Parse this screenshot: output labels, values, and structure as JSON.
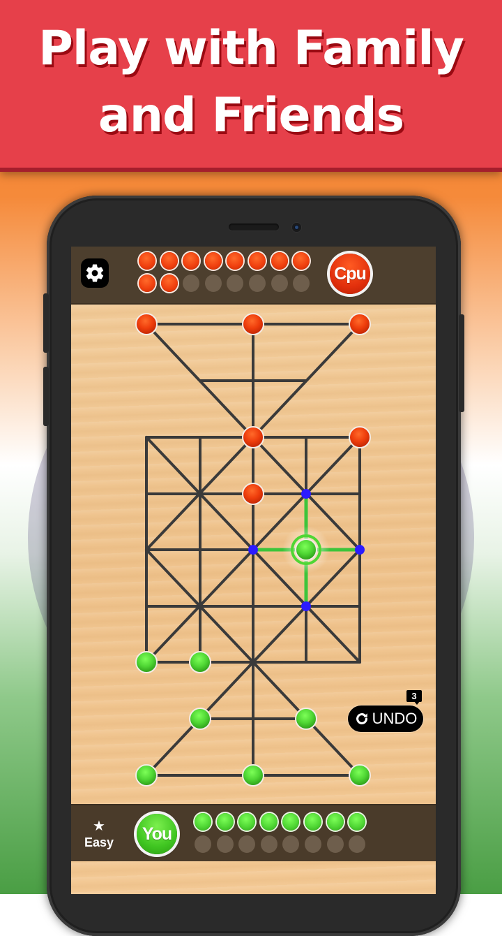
{
  "banner": {
    "line1": "Play with Family",
    "line2": "and Friends"
  },
  "colors": {
    "banner": "#e6404a",
    "red_piece": "#f0400f",
    "green_piece": "#4fd634",
    "move_hint": "#2b1bff",
    "board_line": "#3a3a3a",
    "bar": "#4d3f2e"
  },
  "top_bar": {
    "settings_icon": "gear-icon",
    "opponent_label": "Cpu",
    "captured_slots": [
      "red",
      "red",
      "red",
      "red",
      "red",
      "red",
      "red",
      "red",
      "red",
      "red",
      "empty",
      "empty",
      "empty",
      "empty",
      "empty",
      "empty"
    ]
  },
  "bottom_bar": {
    "difficulty_icon": "star-icon",
    "difficulty_label": "Easy",
    "player_label": "You",
    "captured_slots": [
      "green",
      "green",
      "green",
      "green",
      "green",
      "green",
      "green",
      "green",
      "empty",
      "empty",
      "empty",
      "empty",
      "empty",
      "empty",
      "empty",
      "empty"
    ]
  },
  "undo": {
    "label": "UNDO",
    "icon": "undo-arrow-icon",
    "remaining": "3"
  },
  "board": {
    "red_pieces": [
      [
        0,
        0
      ],
      [
        2,
        0
      ],
      [
        4,
        0
      ],
      [
        2,
        2
      ],
      [
        4,
        2
      ],
      [
        2,
        3
      ]
    ],
    "green_pieces": [
      [
        0,
        6
      ],
      [
        1,
        6
      ],
      [
        1,
        7
      ],
      [
        3,
        7
      ],
      [
        0,
        8
      ],
      [
        2,
        8
      ],
      [
        4,
        8
      ]
    ],
    "selected_piece": [
      3,
      4
    ],
    "selected_color": "green",
    "move_hints": [
      [
        3,
        3
      ],
      [
        2,
        4
      ],
      [
        4,
        4
      ],
      [
        3,
        5
      ]
    ]
  }
}
